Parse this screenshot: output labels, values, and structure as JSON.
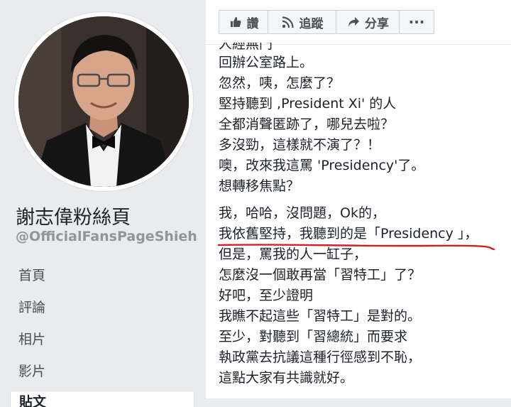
{
  "left": {
    "page_name": "謝志偉粉絲頁",
    "page_handle": "@OfficialFansPageShieh",
    "nav": [
      "首頁",
      "評論",
      "相片",
      "影片",
      "貼文"
    ]
  },
  "actions": {
    "like": "讚",
    "follow": "追蹤",
    "share": "分享",
    "more": "···"
  },
  "post": {
    "lines_block1": [
      "人經無門",
      "回辦公室路上。",
      "忽然，咦，怎麼了？",
      "堅持聽到 ,President Xi' 的人",
      "全都消聲匿跡了，哪兒去啦？",
      "多沒勁，這樣就不演了？！",
      "噢，改來我這罵 'Presidency'了。",
      "想轉移焦點？"
    ],
    "lines_block2": [
      "我，哈哈，沒問題，Ok的，",
      "我依舊堅持，我聽到的是「Presidency 」，",
      "但是，罵我的人一缸子，",
      "怎麼沒一個敢再當「習特工」了？",
      "好吧，至少證明",
      "我瞧不起這些「習特工」是對的。",
      "至少，對聽到「習總統」而要求",
      "執政黨去抗議這種行徑感到不恥，",
      "這點大家有共識就好。"
    ]
  },
  "colors": {
    "background": "#e9ebee",
    "text": "#1d2129",
    "handle": "#90949c",
    "underline": "#d0202a"
  }
}
